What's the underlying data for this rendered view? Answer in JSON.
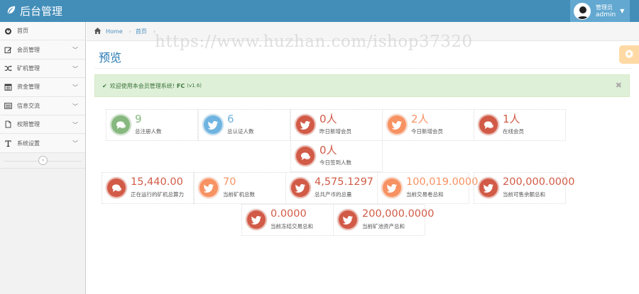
{
  "header": {
    "brand": "后台管理",
    "user_role": "管理员",
    "user_name": "admin"
  },
  "sidebar": {
    "items": [
      {
        "label": "首页",
        "icon": "dashboard-icon",
        "has_arrow": false
      },
      {
        "label": "会员管理",
        "icon": "edit-icon",
        "has_arrow": true
      },
      {
        "label": "矿机管理",
        "icon": "random-icon",
        "has_arrow": true
      },
      {
        "label": "资金管理",
        "icon": "calendar-icon",
        "has_arrow": true
      },
      {
        "label": "信息交流",
        "icon": "list-icon",
        "has_arrow": true
      },
      {
        "label": "权限管理",
        "icon": "file-icon",
        "has_arrow": true
      },
      {
        "label": "系统设置",
        "icon": "text-icon",
        "has_arrow": true
      }
    ]
  },
  "breadcrumb": {
    "home": "Home",
    "current": "首页"
  },
  "watermark": "https://www.huzhan.com/ishop37320",
  "page": {
    "title": "预览"
  },
  "alert": {
    "text": "欢迎使用本会员管理系统!",
    "brand": "FC",
    "version": "(v1.6)"
  },
  "stats": [
    {
      "value": "9",
      "label": "总注册人数",
      "color": "green",
      "icon": "comments-icon"
    },
    {
      "value": "6",
      "label": "总认证人数",
      "color": "blue",
      "icon": "twitter-icon"
    },
    {
      "value": "0人",
      "label": "昨日新增会员",
      "color": "red",
      "icon": "twitter-icon"
    },
    {
      "value": "2人",
      "label": "今日新增会员",
      "color": "orange",
      "icon": "twitter-icon"
    },
    {
      "value": "1人",
      "label": "在线会员",
      "color": "red",
      "icon": "comments-icon"
    },
    {
      "value": "0人",
      "label": "今日签到人数",
      "color": "red",
      "icon": "comments-icon"
    },
    {
      "value": "15,440.00",
      "label": "正在运行的矿机总算力",
      "color": "red",
      "icon": "comments-icon"
    },
    {
      "value": "70",
      "label": "当前矿机总数",
      "color": "orange",
      "icon": "twitter-icon"
    },
    {
      "value": "4,575.1297",
      "label": "总共产币的总量",
      "color": "red",
      "icon": "twitter-icon"
    },
    {
      "value": "100,019.0000",
      "label": "当前交易卷总和",
      "color": "orange",
      "icon": "twitter-icon"
    },
    {
      "value": "200,000.0000",
      "label": "当前可售余额总和",
      "color": "red",
      "icon": "twitter-icon"
    },
    {
      "value": "0.0000",
      "label": "当前冻结交易总和",
      "color": "red",
      "icon": "twitter-icon"
    },
    {
      "value": "200,000.0000",
      "label": "当前矿池资产总和",
      "color": "red",
      "icon": "twitter-icon"
    }
  ],
  "colors": {
    "navbar": "#438eb9",
    "green": "#87b87f",
    "blue": "#6fb3e0",
    "red": "#d15b47",
    "orange": "#f79263"
  }
}
